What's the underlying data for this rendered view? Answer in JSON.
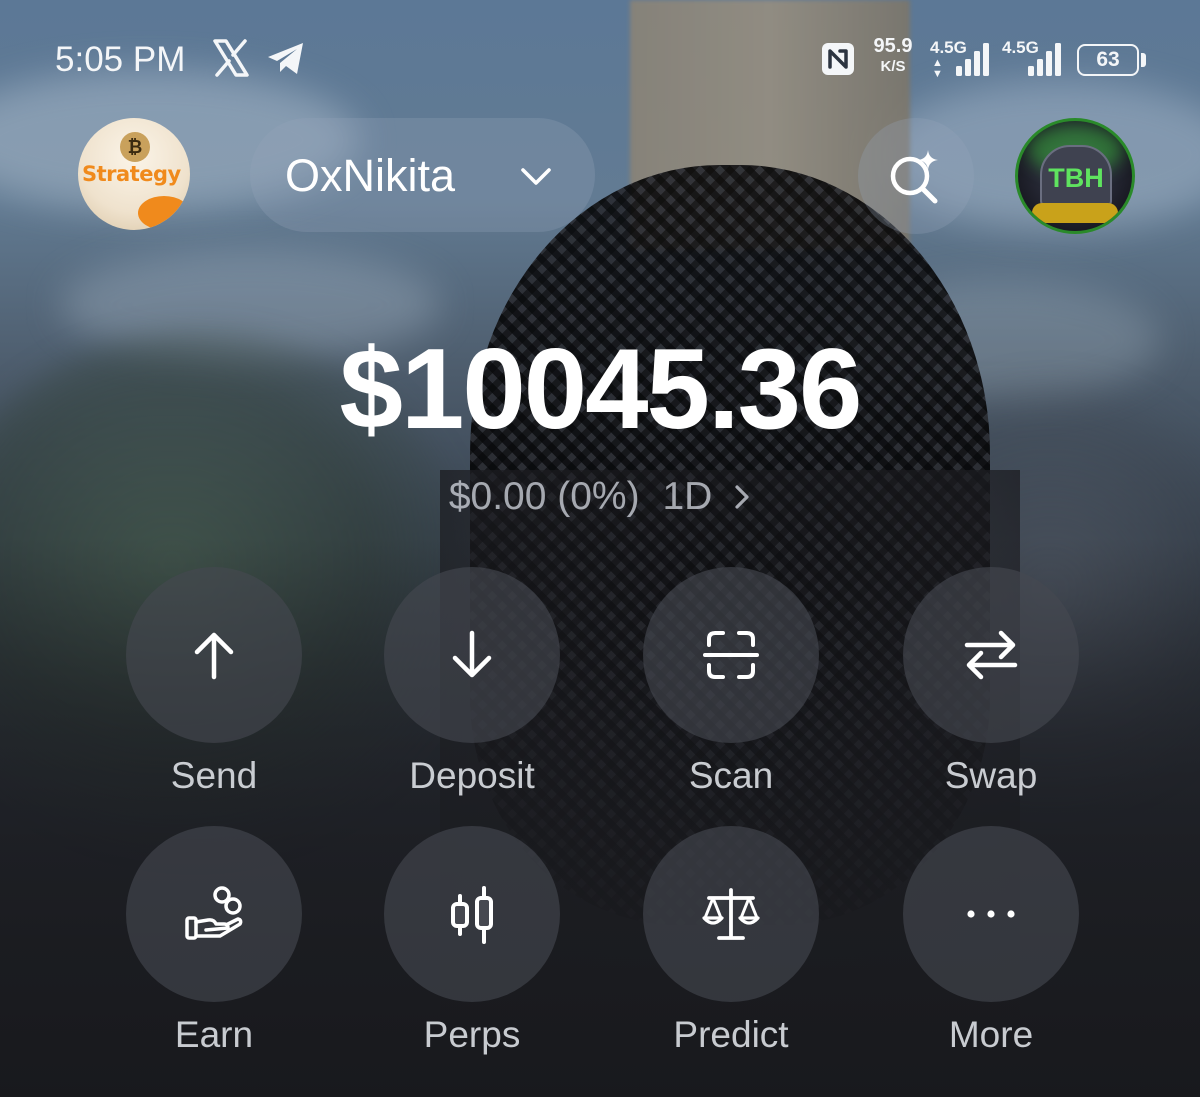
{
  "status_bar": {
    "time": "5:05 PM",
    "speed_value": "95.9",
    "speed_unit": "K/S",
    "network_1": "4.5G",
    "network_2": "4.5G",
    "battery": "63",
    "icons": [
      "x-logo-icon",
      "telegram-icon",
      "nfc-icon",
      "signal-icon",
      "battery-icon"
    ]
  },
  "header": {
    "left_avatar_text": "Strategy",
    "account_name": "OxNikita",
    "right_avatar_text": "TBH",
    "icons": [
      "chevron-down-icon",
      "ai-search-icon"
    ]
  },
  "balance": {
    "amount": "$10045.36",
    "change": "$0.00 (0%)",
    "period": "1D"
  },
  "actions": [
    {
      "label": "Send",
      "icon": "arrow-up-icon"
    },
    {
      "label": "Deposit",
      "icon": "arrow-down-icon"
    },
    {
      "label": "Scan",
      "icon": "scan-icon"
    },
    {
      "label": "Swap",
      "icon": "swap-icon"
    },
    {
      "label": "Earn",
      "icon": "earn-icon"
    },
    {
      "label": "Perps",
      "icon": "candlestick-icon"
    },
    {
      "label": "Predict",
      "icon": "scale-icon"
    },
    {
      "label": "More",
      "icon": "more-icon"
    }
  ],
  "colors": {
    "text": "#ffffff",
    "secondary_text": "#e1e6ee",
    "button_bg": "#46484f",
    "strategy_orange": "#f08a1c",
    "tbh_green": "#5fe35f"
  }
}
